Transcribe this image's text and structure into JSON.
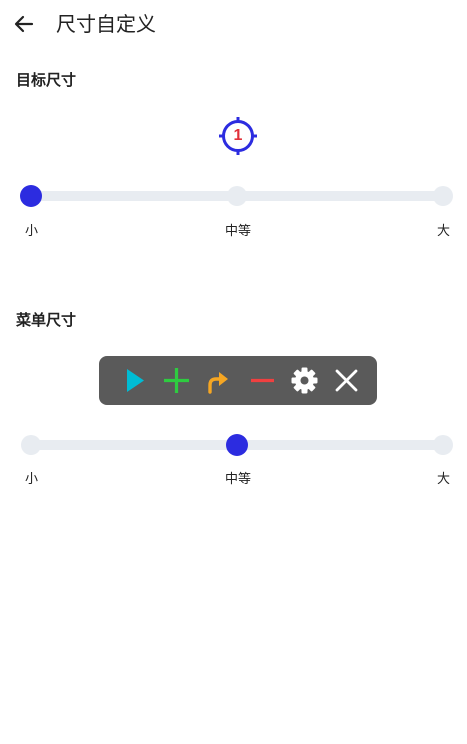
{
  "header": {
    "title": "尺寸自定义",
    "back_icon": "arrow-left-icon"
  },
  "target_size": {
    "title": "目标尺寸",
    "preview": {
      "icon": "crosshair-target-icon",
      "number": "1",
      "ring_color": "#2c2ce0",
      "number_color": "#e0303a"
    },
    "slider": {
      "options": [
        "小",
        "中等",
        "大"
      ],
      "selected_index": 0,
      "selected_label": "小",
      "thumb_color": "#2c2ce0",
      "track_color": "#e8ecf1"
    }
  },
  "menu_size": {
    "title": "菜单尺寸",
    "preview": {
      "background_color": "#5a5a5a",
      "icons": [
        {
          "name": "play-icon",
          "color": "#00bcd4"
        },
        {
          "name": "plus-icon",
          "color": "#2ecc40"
        },
        {
          "name": "curved-arrow-icon",
          "color": "#f5a623"
        },
        {
          "name": "minus-icon",
          "color": "#f04040"
        },
        {
          "name": "gear-icon",
          "color": "#ffffff"
        },
        {
          "name": "close-icon",
          "color": "#ffffff"
        }
      ]
    },
    "slider": {
      "options": [
        "小",
        "中等",
        "大"
      ],
      "selected_index": 1,
      "selected_label": "中等",
      "thumb_color": "#2c2ce0",
      "track_color": "#e8ecf1"
    }
  }
}
